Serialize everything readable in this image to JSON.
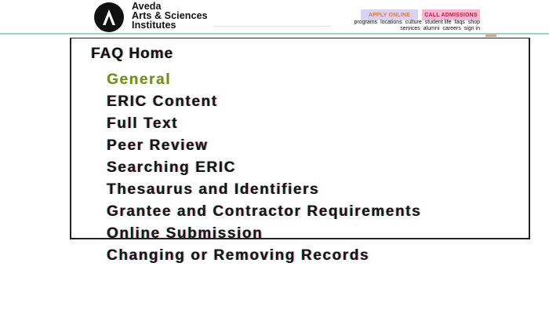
{
  "header": {
    "logo": {
      "icon": "aveda-a-icon",
      "line1": "Aveda",
      "line2": "Arts & Sciences",
      "line3": "Institutes"
    },
    "apply_button": "APPLY ONLINE",
    "call_button": "CALL ADMISSIONS",
    "nav_row_1": [
      "programs",
      "locations",
      "culture",
      "student life",
      "faqs",
      "shop"
    ],
    "nav_row_2": [
      "services",
      "alumni",
      "careers",
      "sign in"
    ]
  },
  "faq": {
    "heading": "FAQ Home",
    "items": [
      {
        "label": "General",
        "active": true
      },
      {
        "label": "ERIC Content"
      },
      {
        "label": "Full Text"
      },
      {
        "label": "Peer Review"
      },
      {
        "label": "Searching ERIC"
      },
      {
        "label": "Thesaurus and Identifiers"
      },
      {
        "label": "Grantee and Contractor Requirements"
      },
      {
        "label": "Online Submission"
      },
      {
        "label": "Changing or Removing Records"
      }
    ]
  },
  "colors": {
    "active_link": "#6f8f1f",
    "apply_bg": "#d8d2f4",
    "call_bg": "#f3b8d4",
    "header_line": "#9fd3c9"
  }
}
